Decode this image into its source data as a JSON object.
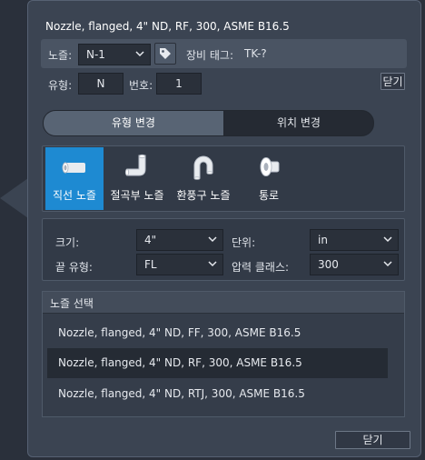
{
  "title": "Nozzle, flanged, 4\" ND, RF, 300, ASME B16.5",
  "header": {
    "nozzle_label": "노즐:",
    "nozzle_value": "N-1",
    "equip_tag_label": "장비 태그:",
    "equip_tag_value": "TK-?",
    "type_label": "유형:",
    "type_value": "N",
    "number_label": "번호:",
    "number_value": "1",
    "close_label": "닫기"
  },
  "tabs": [
    {
      "label": "유형 변경",
      "active": true
    },
    {
      "label": "위치 변경",
      "active": false
    }
  ],
  "types": [
    {
      "label": "직선 노즐",
      "icon": "straight-nozzle-icon",
      "active": true
    },
    {
      "label": "절곡부 노즐",
      "icon": "elbow-nozzle-icon",
      "active": false
    },
    {
      "label": "환풍구 노즐",
      "icon": "vent-nozzle-icon",
      "active": false
    },
    {
      "label": "통로",
      "icon": "manway-icon",
      "active": false
    }
  ],
  "properties": {
    "size_label": "크기:",
    "size_value": "4\"",
    "unit_label": "단위:",
    "unit_value": "in",
    "end_type_label": "끝 유형:",
    "end_type_value": "FL",
    "pressure_label": "압력 클래스:",
    "pressure_value": "300"
  },
  "nozzle_select": {
    "header": "노즐 선택",
    "items": [
      {
        "label": "Nozzle, flanged, 4\" ND, FF, 300, ASME B16.5",
        "selected": false
      },
      {
        "label": "Nozzle, flanged, 4\" ND, RF, 300, ASME B16.5",
        "selected": true
      },
      {
        "label": "Nozzle, flanged, 4\" ND, RTJ, 300, ASME B16.5",
        "selected": false
      }
    ]
  },
  "footer": {
    "close_label": "닫기"
  },
  "colors": {
    "accent": "#1e8ad2",
    "panel": "#3b4452",
    "field": "#2a303a"
  }
}
